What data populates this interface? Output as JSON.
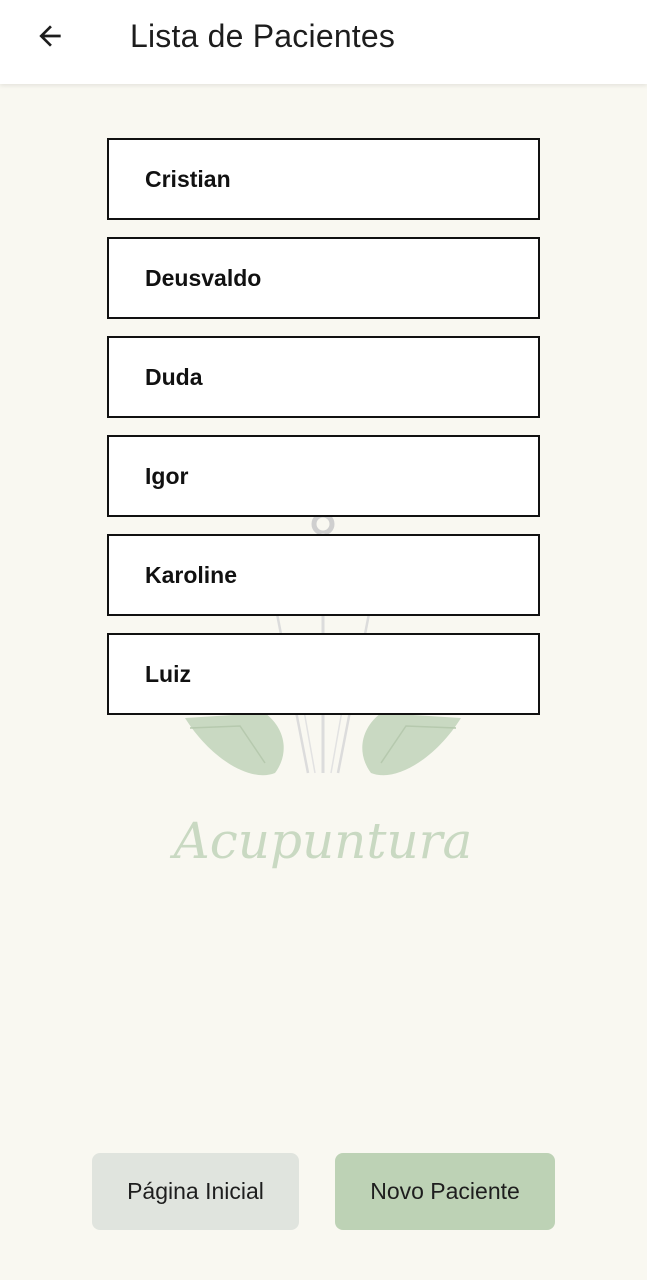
{
  "header": {
    "title": "Lista de Pacientes",
    "back_icon": "arrow-left-icon"
  },
  "patients": [
    {
      "name": "Cristian"
    },
    {
      "name": "Deusvaldo"
    },
    {
      "name": "Duda"
    },
    {
      "name": "Igor"
    },
    {
      "name": "Karoline"
    },
    {
      "name": "Luiz"
    }
  ],
  "watermark": {
    "text": "Acupuntura",
    "leaf_color": "#c9d9c2",
    "needle_color": "#d2d2d2"
  },
  "footer": {
    "home_label": "Página Inicial",
    "new_patient_label": "Novo Paciente"
  },
  "colors": {
    "background": "#f9f8f1",
    "home_button": "#e0e4de",
    "new_button": "#bdd2b5"
  }
}
